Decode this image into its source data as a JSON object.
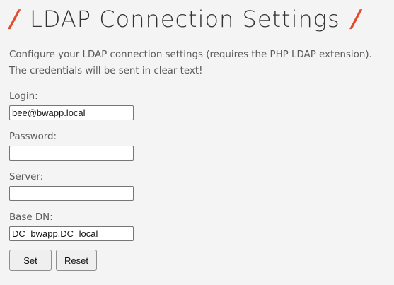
{
  "page": {
    "title": "LDAP Connection Settings",
    "slash_left": "/",
    "slash_right": "/",
    "description_line1": "Configure your LDAP connection settings (requires the PHP LDAP extension).",
    "description_line2": "The credentials will be sent in clear text!"
  },
  "form": {
    "login_label": "Login:",
    "login_value": "bee@bwapp.local",
    "password_label": "Password:",
    "password_value": "",
    "server_label": "Server:",
    "server_value": "",
    "basedn_label": "Base DN:",
    "basedn_value": "DC=bwapp,DC=local",
    "set_label": "Set",
    "reset_label": "Reset"
  },
  "colors": {
    "accent": "#e24c2d",
    "background": "#f4f4f4"
  }
}
